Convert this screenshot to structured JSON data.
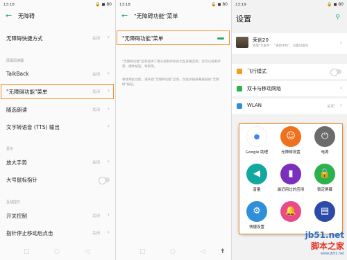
{
  "panel1": {
    "status_time": "13:18",
    "status_right": "🔒 ◼ 80",
    "title": "无障碍",
    "rows": [
      {
        "label": "无障碍快捷方式",
        "value": "关闭"
      },
      {
        "label": "TalkBack",
        "value": "关闭"
      },
      {
        "label": "\"无障碍功能\"菜单",
        "value": "关闭"
      },
      {
        "label": "随选朗读",
        "value": "关闭"
      },
      {
        "label": "文字转语音 (TTS) 输出",
        "value": ""
      },
      {
        "label": "放大手势",
        "value": "关闭"
      },
      {
        "label": "大号鼠标指针",
        "value": ""
      },
      {
        "label": "开关控制",
        "value": "关闭"
      },
      {
        "label": "指针停止移动后点击",
        "value": "关闭"
      }
    ],
    "sections": [
      "屏幕阅读器",
      "显示",
      "互动控件"
    ]
  },
  "panel2": {
    "status_time": "13:18",
    "status_right": "🔒 ◼ 80",
    "title": "\"无障碍功能\"菜单",
    "toggle_label": "\"无障碍功能\"菜单",
    "desc1": "\"无障碍功能\"菜单提供了用于控制手机的大型屏幕菜单。您可以控制手势、硬件按钮、导航等。",
    "desc2": "要使用此功能，请开启\"无障碍功能\"菜单，然后点按屏幕底部的\"无障碍\"按钮。"
  },
  "panel3": {
    "status_time": "13:19",
    "status_right": "🔒 ◼ 80",
    "title": "设置",
    "account_name": "荣创20",
    "account_sub": "管理\"云服务\"、\"查找手机\"、设置设备等",
    "rows": [
      {
        "label": "飞行模式",
        "value": ""
      },
      {
        "label": "双卡与移动网络",
        "value": ""
      },
      {
        "label": "WLAN",
        "value": "关闭"
      }
    ],
    "menu": [
      {
        "label": "Google 助理",
        "icon": "google-assistant-icon",
        "color": "#ffffff"
      },
      {
        "label": "无障碍设置",
        "icon": "accessibility-icon",
        "color": "#f0711d"
      },
      {
        "label": "电源",
        "icon": "power-icon",
        "color": "#6b6b6b"
      },
      {
        "label": "音量",
        "icon": "volume-icon",
        "color": "#11a8a0"
      },
      {
        "label": "最近用过的应用",
        "icon": "recent-apps-icon",
        "color": "#7b2fbd"
      },
      {
        "label": "锁定屏幕",
        "icon": "lock-icon",
        "color": "#2bb24c"
      },
      {
        "label": "快捷设置",
        "icon": "settings-icon",
        "color": "#2f8fd8"
      },
      {
        "label": "",
        "icon": "bell-icon",
        "color": "#e94b8a"
      },
      {
        "label": "",
        "icon": "screenshot-icon",
        "color": "#2c4aa8"
      }
    ]
  },
  "watermark": {
    "a": "jb51.net",
    "b": "脚本之家",
    "c": "www.jb51.net"
  }
}
